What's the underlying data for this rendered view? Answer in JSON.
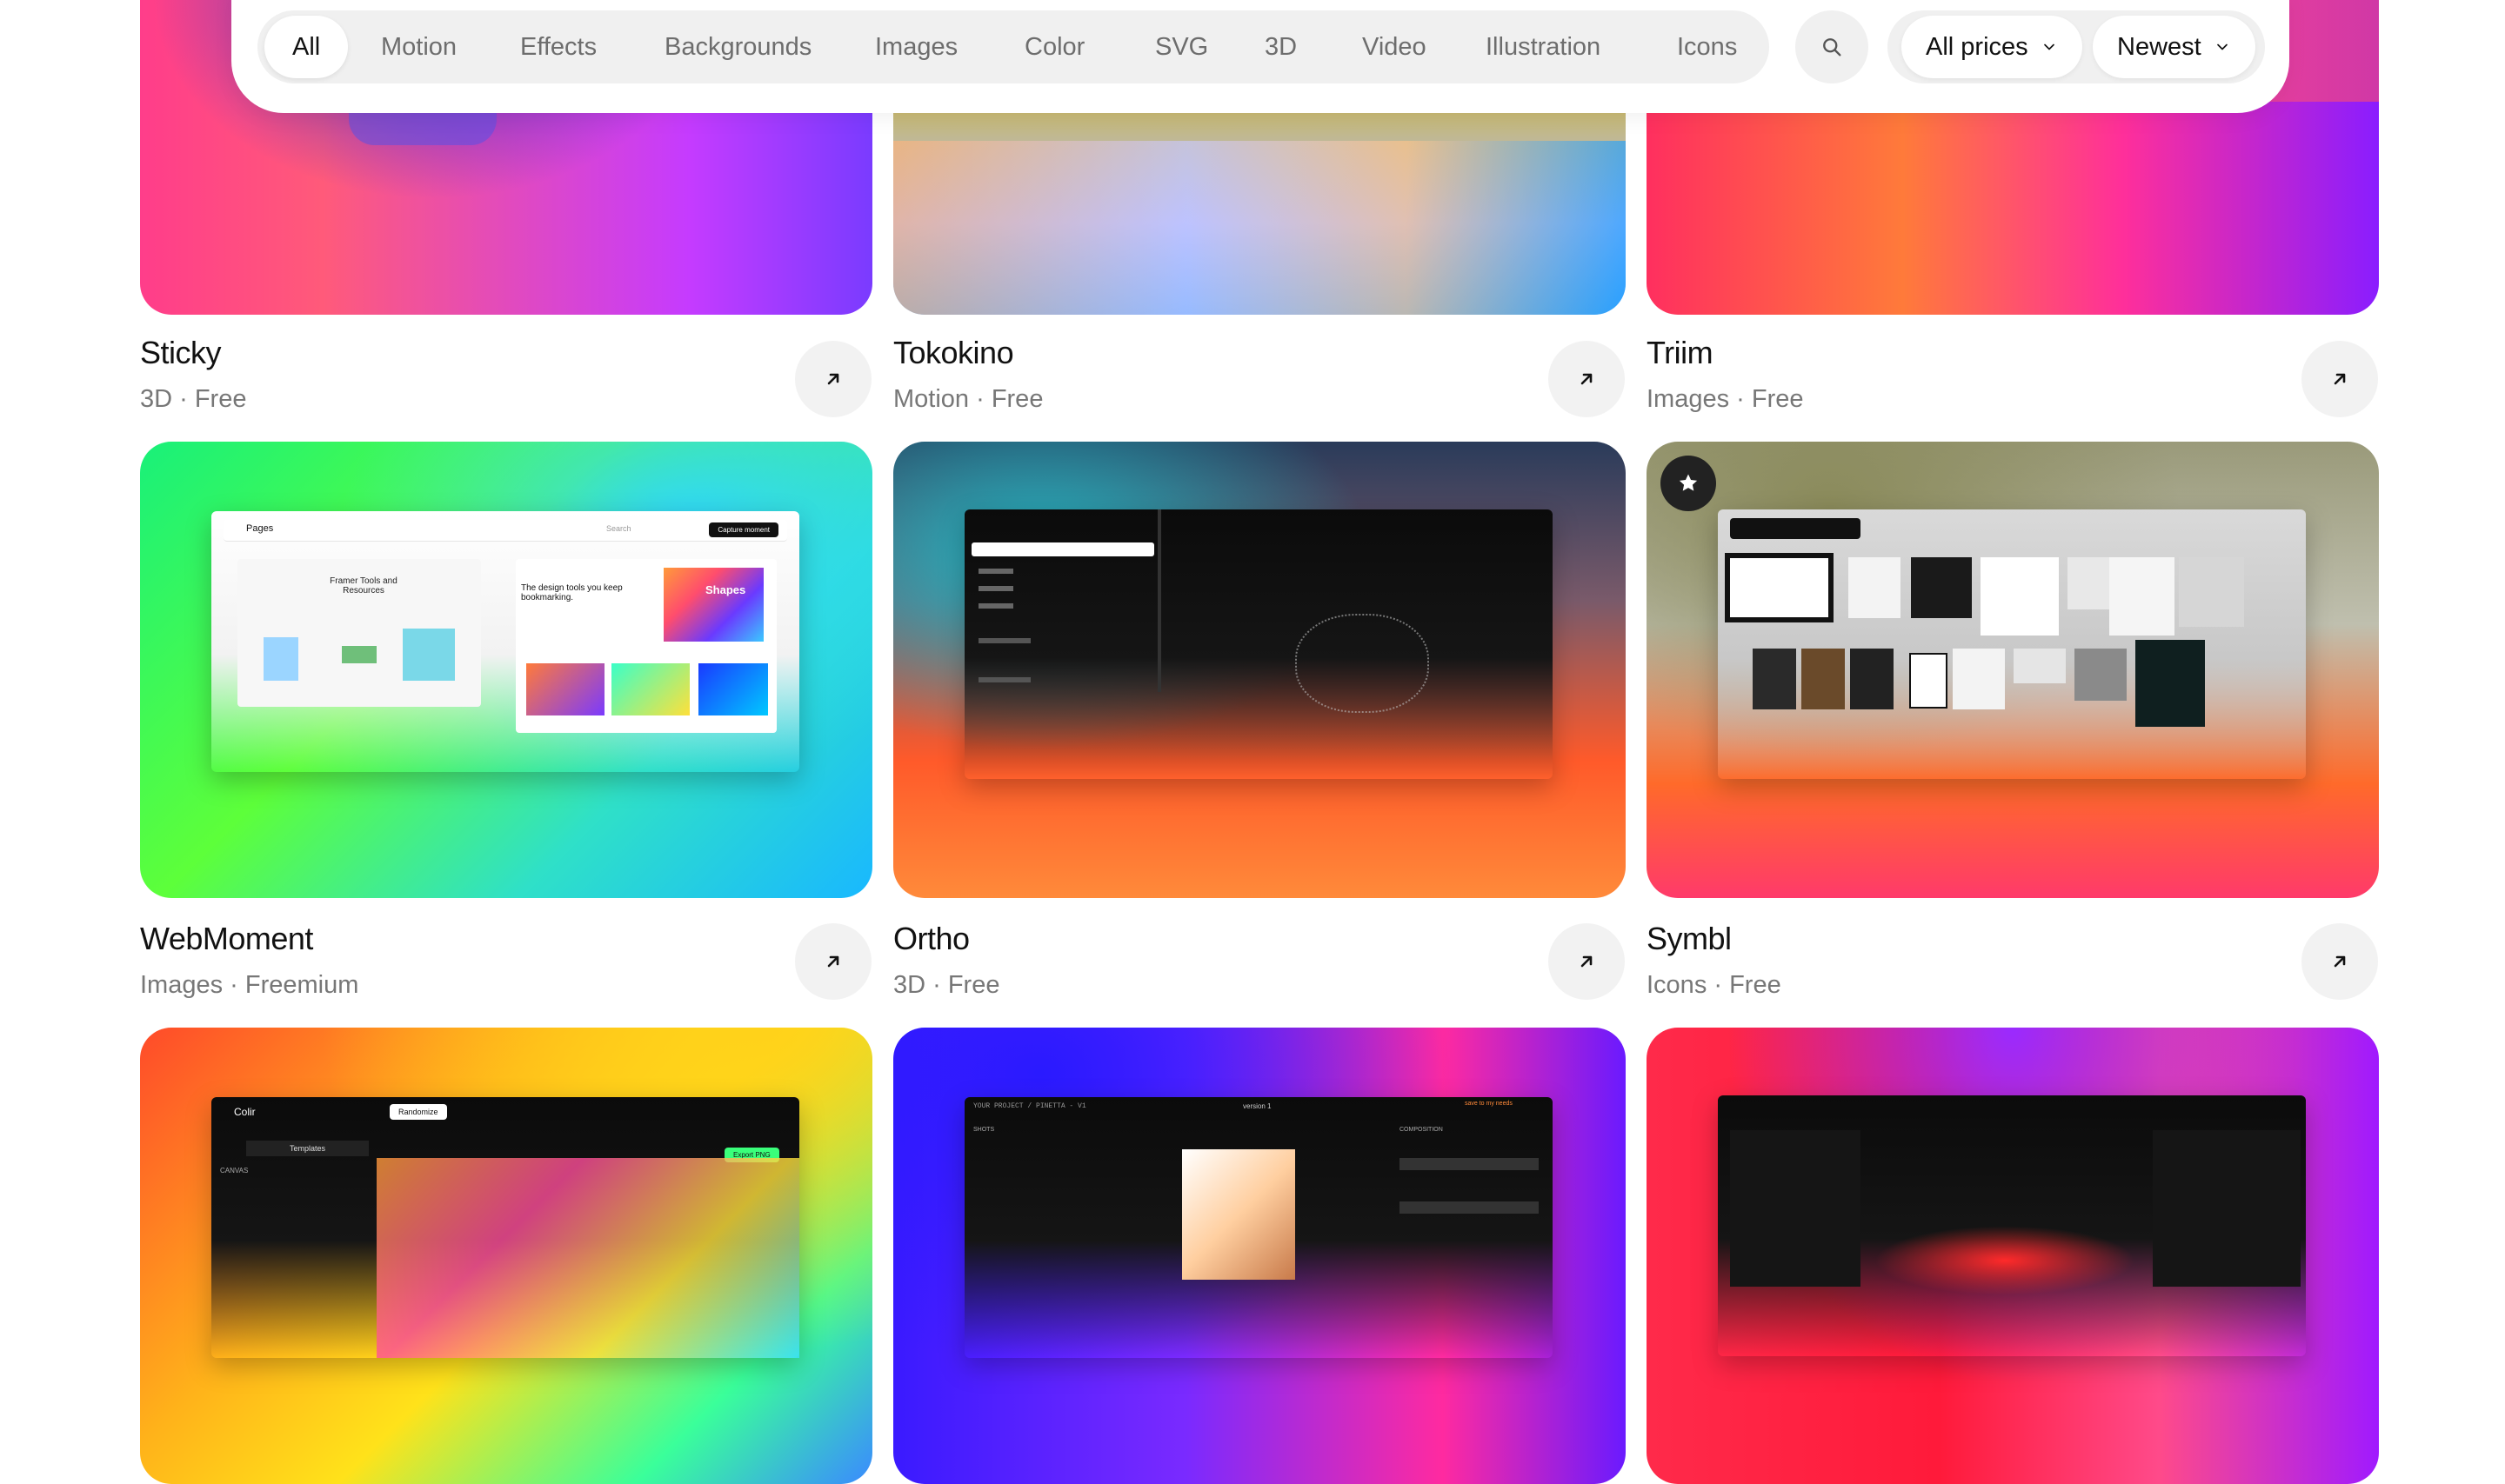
{
  "filters": {
    "categories": [
      "All",
      "Motion",
      "Effects",
      "Backgrounds",
      "Images",
      "Color",
      "SVG",
      "3D",
      "Video",
      "Illustration",
      "Icons"
    ],
    "active": "All",
    "price_select": "All prices",
    "sort_select": "Newest"
  },
  "cards": [
    {
      "title": "Sticky",
      "meta": "3D · Free",
      "featured": false
    },
    {
      "title": "Tokokino",
      "meta": "Motion · Free",
      "featured": false
    },
    {
      "title": "Triim",
      "meta": "Images · Free",
      "featured": false
    },
    {
      "title": "WebMoment",
      "meta": "Images · Freemium",
      "featured": false
    },
    {
      "title": "Ortho",
      "meta": "3D · Free",
      "featured": false
    },
    {
      "title": "Symbl",
      "meta": "Icons · Free",
      "featured": true
    },
    {
      "title": "",
      "meta": "",
      "featured": false
    },
    {
      "title": "",
      "meta": "",
      "featured": false
    },
    {
      "title": "",
      "meta": "",
      "featured": false
    }
  ],
  "mock_text": {
    "webmoment_pages": "Pages",
    "webmoment_search": "Search",
    "webmoment_capture": "Capture moment",
    "webmoment_heading1": "Framer Tools and Resources",
    "webmoment_heading2": "The design tools you keep bookmarking.",
    "webmoment_shapes": "Shapes",
    "colir_brand": "Colir",
    "colir_randomize": "Randomize",
    "colir_templates": "Templates",
    "colir_canvas": "CANVAS",
    "colir_export": "Export PNG",
    "pinetta_project": "YOUR PROJECT / PINETTA - V1",
    "pinetta_version": "version 1",
    "pinetta_composition": "COMPOSITION",
    "pinetta_shots": "SHOTS",
    "pinetta_save": "save to my needs"
  },
  "colors": {
    "accent_dark": "#111111",
    "pill_bg": "#f0f0f0",
    "muted_text": "#777777"
  }
}
